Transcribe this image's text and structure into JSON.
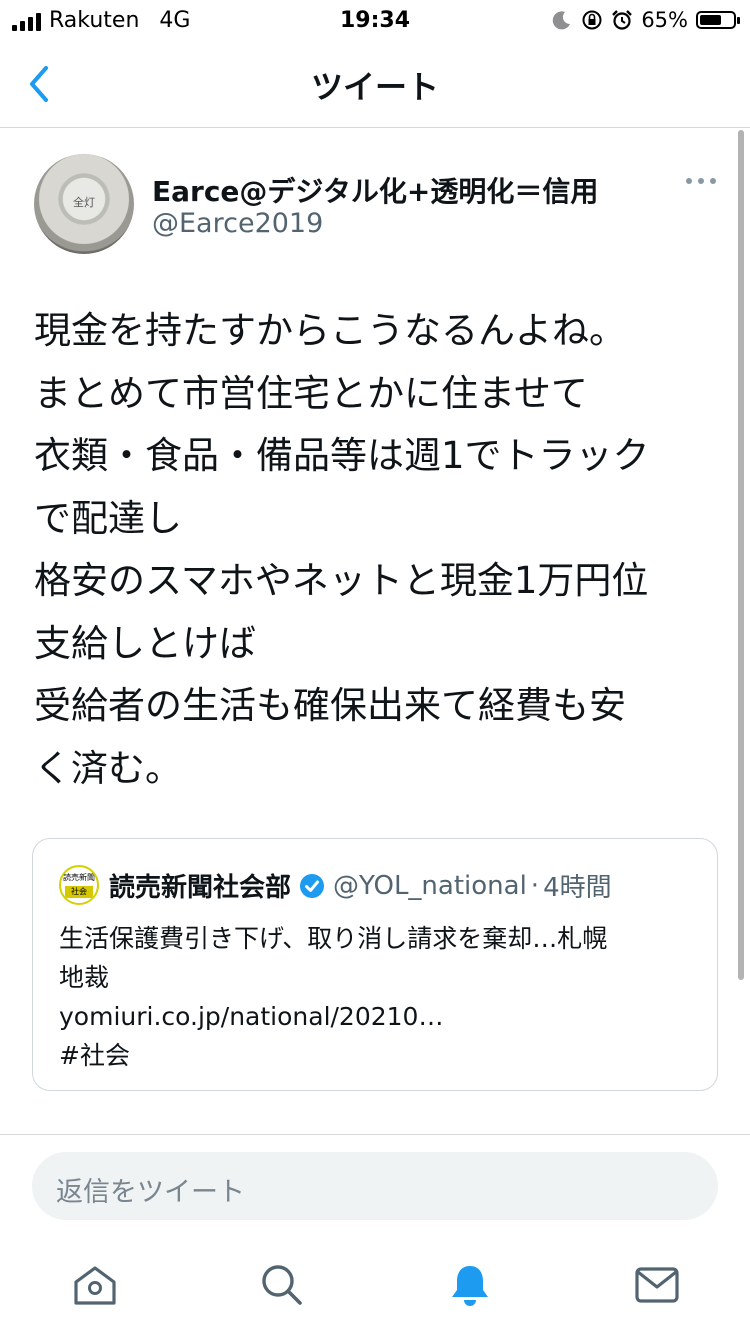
{
  "status": {
    "carrier": "Rakuten",
    "network": "4G",
    "time": "19:34",
    "battery": "65%",
    "battery_level": 0.65
  },
  "nav": {
    "title": "ツイート",
    "back_icon": "chevron-left-icon"
  },
  "tweet": {
    "avatar_text": "全灯",
    "display_name": "Earce@デジタル化+透明化＝信用",
    "handle": "@Earce2019",
    "lines": [
      "現金を持たすからこうなるんよね。",
      "まとめて市営住宅とかに住ませて",
      "衣類・食品・備品等は週1でトラック",
      "で配達し",
      "格安のスマホやネットと現金1万円位",
      "支給しとけば",
      "受給者の生活も確保出来て経費も安",
      "く済む。"
    ]
  },
  "quote": {
    "avatar_top": "読売新聞",
    "avatar_bottom": "社会",
    "name": "読売新聞社会部",
    "handle": "@YOL_national",
    "separator": "·",
    "time": "4時間",
    "lines": [
      "生活保護費引き下げ、取り消し請求を棄却…札幌",
      "地裁",
      "yomiuri.co.jp/national/20210…",
      "#社会"
    ]
  },
  "reply": {
    "placeholder": "返信をツイート"
  },
  "tabs": [
    {
      "icon": "home-icon"
    },
    {
      "icon": "search-icon"
    },
    {
      "icon": "notifications-icon"
    },
    {
      "icon": "messages-icon"
    }
  ],
  "colors": {
    "accent": "#1d9bf0",
    "secondary_text": "#536471"
  }
}
